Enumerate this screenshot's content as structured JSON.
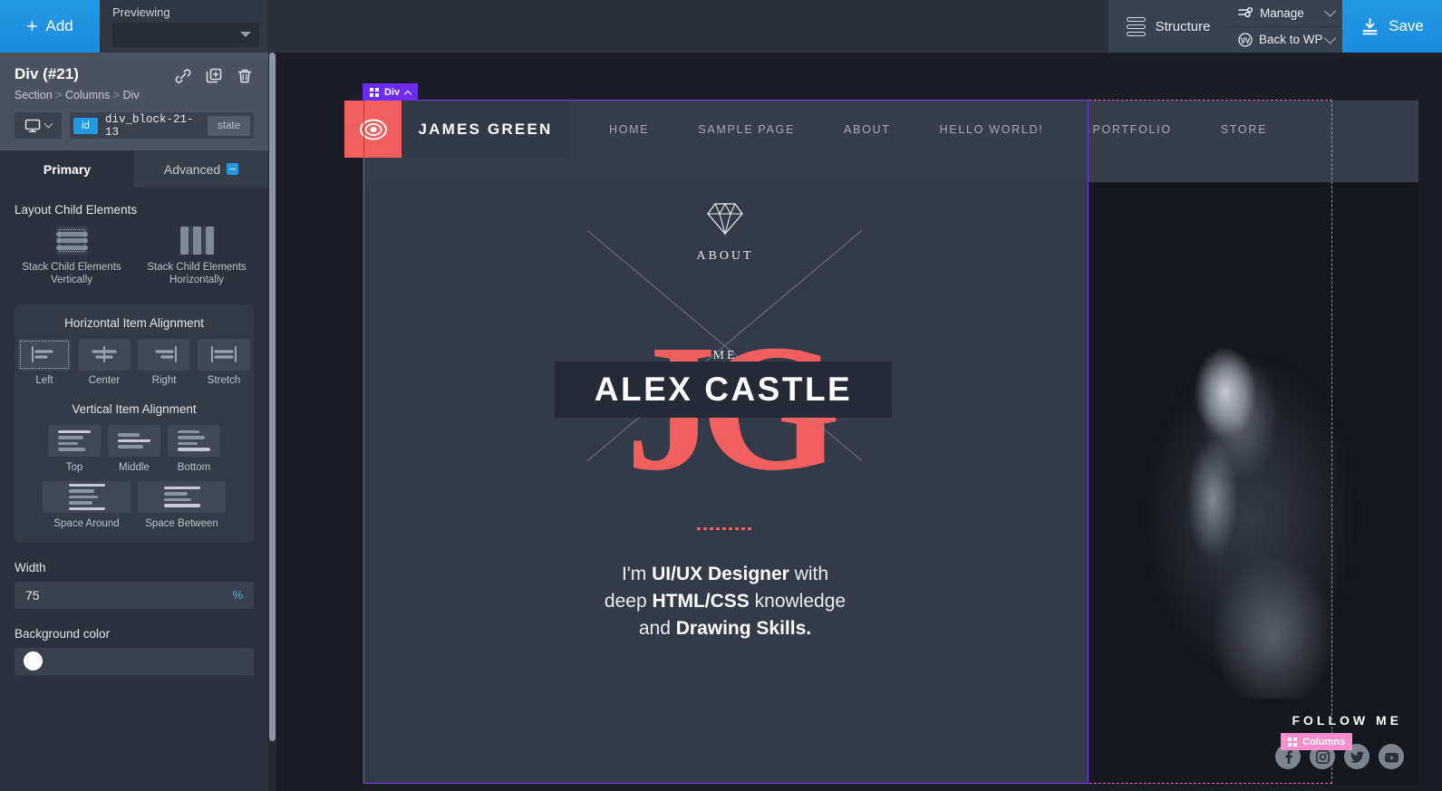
{
  "topbar": {
    "add_label": "Add",
    "previewing_label": "Previewing",
    "previewing_value": "",
    "structure_label": "Structure",
    "manage_label": "Manage",
    "back_to_wp_label": "Back to WP",
    "save_label": "Save",
    "accent_blue": "#2399e5"
  },
  "sidebar": {
    "title": "Div (#21)",
    "breadcrumb": {
      "a": "Section",
      "sep1": ">",
      "b": "Columns",
      "sep2": ">",
      "c": "Div"
    },
    "id_chip": "id",
    "id_value": "div_block-21-13",
    "state_chip": "state",
    "tabs": [
      {
        "label": "Primary",
        "active": true
      },
      {
        "label": "Advanced",
        "active": false
      }
    ],
    "layout": {
      "section_title": "Layout Child Elements",
      "options": [
        {
          "label": "Stack Child Elements Vertically",
          "selected": true
        },
        {
          "label": "Stack Child Elements Horizontally",
          "selected": false
        }
      ]
    },
    "horizontal_alignment": {
      "title": "Horizontal Item Alignment",
      "options": [
        {
          "label": "Left",
          "selected": true
        },
        {
          "label": "Center",
          "selected": false
        },
        {
          "label": "Right",
          "selected": false
        },
        {
          "label": "Stretch",
          "selected": false
        }
      ]
    },
    "vertical_alignment": {
      "title": "Vertical Item Alignment",
      "options": [
        {
          "label": "Top",
          "selected": false
        },
        {
          "label": "Middle",
          "selected": false
        },
        {
          "label": "Bottom",
          "selected": false
        },
        {
          "label": "Space Around",
          "selected": false
        },
        {
          "label": "Space Between",
          "selected": false
        }
      ]
    },
    "width": {
      "label": "Width",
      "value": "75",
      "unit": "%"
    },
    "background_color": {
      "label": "Background color",
      "value": "#ffffff"
    }
  },
  "canvas": {
    "div_badge": "Div",
    "columns_badge": "Columns",
    "selection_purple": "#7b3cf0",
    "selection_pink": "#e85fc0"
  },
  "site": {
    "brand": "JAMES GREEN",
    "logo_accent": "#f1605f",
    "nav": [
      "HOME",
      "SAMPLE PAGE",
      "ABOUT",
      "HELLO WORLD!",
      "PORTFOLIO",
      "STORE"
    ],
    "hero": {
      "watermark": "JG",
      "eyebrow_top": "ABOUT",
      "eyebrow_bottom": "ME",
      "title": "ALEX CASTLE",
      "tagline_line1_a": "I'm ",
      "tagline_line1_b": "UI/UX Designer",
      "tagline_line1_c": " with",
      "tagline_line2_a": "deep ",
      "tagline_line2_b": "HTML/CSS",
      "tagline_line2_c": " knowledge",
      "tagline_line3_a": "and ",
      "tagline_line3_b": "Drawing Skills."
    },
    "follow": {
      "label": "FOLLOW ME",
      "icons": [
        "facebook-icon",
        "instagram-icon",
        "twitter-icon",
        "youtube-icon"
      ]
    }
  }
}
